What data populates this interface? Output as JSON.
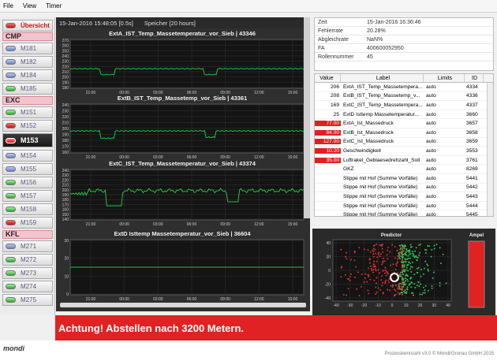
{
  "menu": [
    "File",
    "View",
    "Timer"
  ],
  "sidebar": {
    "overview_label": "Übersicht",
    "groups": [
      {
        "name": "CMP",
        "items": [
          {
            "label": "M181",
            "state": "blue"
          },
          {
            "label": "M182",
            "state": "blue"
          },
          {
            "label": "M184",
            "state": "blue"
          },
          {
            "label": "M185",
            "state": "green"
          }
        ]
      },
      {
        "name": "EXC",
        "items": [
          {
            "label": "M151",
            "state": "green"
          },
          {
            "label": "M152",
            "state": "red"
          },
          {
            "label": "M153",
            "state": "red",
            "active": true
          },
          {
            "label": "M154",
            "state": "blue"
          },
          {
            "label": "M155",
            "state": "blue"
          },
          {
            "label": "M156",
            "state": "green"
          },
          {
            "label": "M157",
            "state": "green"
          },
          {
            "label": "M158",
            "state": "green"
          },
          {
            "label": "M159",
            "state": "red"
          }
        ]
      },
      {
        "name": "KFL",
        "items": [
          {
            "label": "M271",
            "state": "blue"
          },
          {
            "label": "M272",
            "state": "green"
          },
          {
            "label": "M273",
            "state": "green"
          },
          {
            "label": "M274",
            "state": "green"
          },
          {
            "label": "M275",
            "state": "green"
          }
        ]
      }
    ]
  },
  "charts_header": {
    "timestamp": "15-Jan-2016 15:48:05 [0.5s]",
    "memory": "Speicher [20 hours]"
  },
  "charts": [
    {
      "title": "ExtA_IST_Temp_Massetemperatur_vor_Sieb | 43346",
      "yticks": [
        "270",
        "260",
        "250",
        "240",
        "230",
        "220",
        "210",
        "200",
        "190",
        "180"
      ]
    },
    {
      "title": "ExtB_IST_Temp_Massetemp_vor_Sieb | 43361",
      "yticks": [
        "240",
        "230",
        "220",
        "210",
        "200",
        "190",
        "180",
        "170",
        "160"
      ]
    },
    {
      "title": "ExtC_IST_Temp_Massetemperatur_vor_Sieb | 43374",
      "yticks": [
        "240",
        "230",
        "220",
        "210",
        "200",
        "190",
        "180",
        "170",
        "160",
        "150",
        "140"
      ]
    },
    {
      "title": "ExtD Isttemp Massetemperatur_vor_Sieb | 36604",
      "yticks": [
        "30",
        "20",
        "10",
        "0"
      ]
    }
  ],
  "xticks": [
    "21:00",
    "00:00",
    "03:00",
    "06:00",
    "09:00",
    "12:00",
    "15:00"
  ],
  "info": [
    {
      "k": "Zeit",
      "v": "15-Jan-2016 16:36:46"
    },
    {
      "k": "Fehlerrate",
      "v": "20.28%"
    },
    {
      "k": "Abgleichrate",
      "v": "NaN%"
    },
    {
      "k": "FA",
      "v": "400600052950"
    },
    {
      "k": "Rollennummer",
      "v": "45"
    }
  ],
  "table": {
    "headers": [
      "Value",
      "Label",
      "Limits",
      "ID"
    ],
    "rows": [
      {
        "value": "206",
        "label": "ExtA_IST_Temp_Massetempera...",
        "limits": "auto",
        "id": "4334",
        "style": ""
      },
      {
        "value": "208",
        "label": "ExtB_IST_Temp_Massetemp_v...",
        "limits": "auto",
        "id": "4336",
        "style": ""
      },
      {
        "value": "169",
        "label": "ExtC_IST_Temp_Massetempera...",
        "limits": "auto",
        "id": "4337",
        "style": ""
      },
      {
        "value": "25",
        "label": "ExtD Isttemp Massetemperatur...",
        "limits": "auto",
        "id": "3660",
        "style": ""
      },
      {
        "value": "77.00",
        "label": "ExtA_Ist_Massedruck",
        "limits": "auto",
        "id": "3657",
        "style": "red"
      },
      {
        "value": "84.00",
        "label": "ExtB_Ist_Massedruck",
        "limits": "auto",
        "id": "3658",
        "style": "red"
      },
      {
        "value": "127.00",
        "label": "ExtC_Ist_Massedruck",
        "limits": "auto",
        "id": "3659",
        "style": "red"
      },
      {
        "value": "10.20",
        "label": "Geschwindigkeit",
        "limits": "auto",
        "id": "3553",
        "style": "red"
      },
      {
        "value": "35.00",
        "label": "Luftrakel_Geblaesedrehzahl_Soll",
        "limits": "auto",
        "id": "3761",
        "style": "red"
      },
      {
        "value": "",
        "label": "GKZ",
        "limits": "auto",
        "id": "8269",
        "style": "black"
      },
      {
        "value": "",
        "label": "Stippe mit Hof (Summe Vorfälle)",
        "limits": "auto",
        "id": "5441",
        "style": "black"
      },
      {
        "value": "",
        "label": "Stippe mit Hof (Summe Vorfälle)",
        "limits": "auto",
        "id": "5442",
        "style": "black"
      },
      {
        "value": "",
        "label": "Stippe mit Hof (Summe Vorfälle)",
        "limits": "auto",
        "id": "5443",
        "style": "black"
      },
      {
        "value": "",
        "label": "Stippe mit Hof (Summe Vorfälle)",
        "limits": "auto",
        "id": "5444",
        "style": "black"
      },
      {
        "value": "",
        "label": "Stippe mit Hof (Summe Vorfälle)",
        "limits": "auto",
        "id": "5445",
        "style": "black"
      }
    ]
  },
  "predictor": {
    "title": "Predictor",
    "ampel_label": "Ampel",
    "xticks": [
      "-40",
      "-30",
      "-20",
      "-10",
      "0",
      "10",
      "20",
      "30",
      "40"
    ],
    "yticks": [
      "40",
      "20",
      "0",
      "-20",
      "-40"
    ]
  },
  "banner": "Achtung! Abstellen nach 3200 Metern.",
  "footer": {
    "logo": "mondi",
    "copyright": "Prozesskennzahl v3.0 © Mondi/Gronau GmbH 2015"
  },
  "colors": {
    "accent_red": "#e02222",
    "trace_green": "#22c040",
    "panel_dark": "#2f2f2f"
  }
}
